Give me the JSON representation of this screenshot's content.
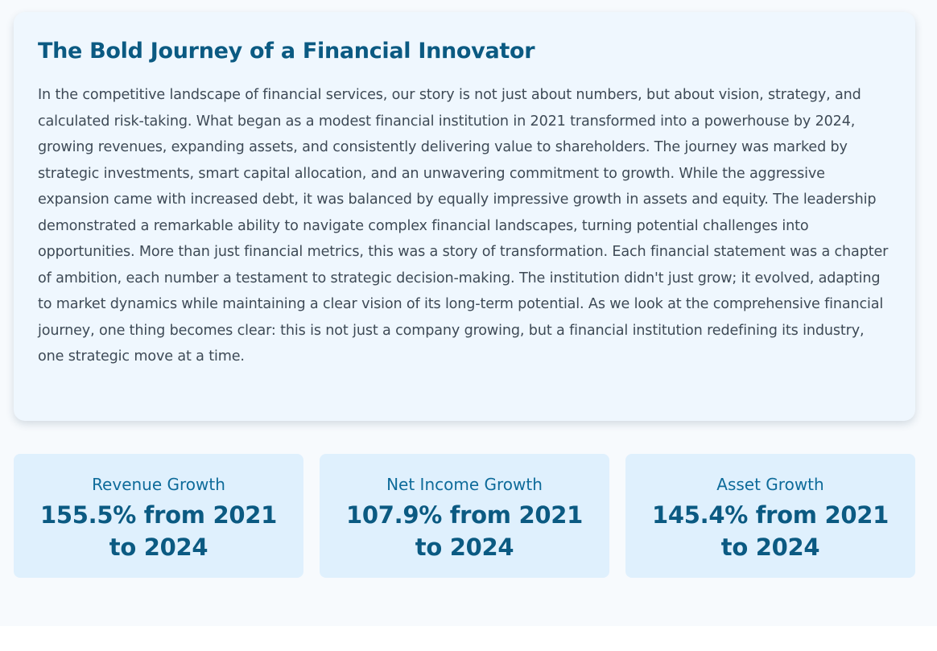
{
  "story": {
    "title": "The Bold Journey of a Financial Innovator",
    "body": "In the competitive landscape of financial services, our story is not just about numbers, but about vision, strategy, and calculated risk-taking. What began as a modest financial institution in 2021 transformed into a powerhouse by 2024, growing revenues, expanding assets, and consistently delivering value to shareholders. The journey was marked by strategic investments, smart capital allocation, and an unwavering commitment to growth. While the aggressive expansion came with increased debt, it was balanced by equally impressive growth in assets and equity. The leadership demonstrated a remarkable ability to navigate complex financial landscapes, turning potential challenges into opportunities. More than just financial metrics, this was a story of transformation. Each financial statement was a chapter of ambition, each number a testament to strategic decision-making. The institution didn't just grow; it evolved, adapting to market dynamics while maintaining a clear vision of its long-term potential. As we look at the comprehensive financial journey, one thing becomes clear: this is not just a company growing, but a financial institution redefining its industry, one strategic move at a time."
  },
  "stats": [
    {
      "label": "Revenue Growth",
      "value": "155.5% from 2021 to 2024"
    },
    {
      "label": "Net Income Growth",
      "value": "107.9% from 2021 to 2024"
    },
    {
      "label": "Asset Growth",
      "value": "145.4% from 2021 to 2024"
    }
  ]
}
